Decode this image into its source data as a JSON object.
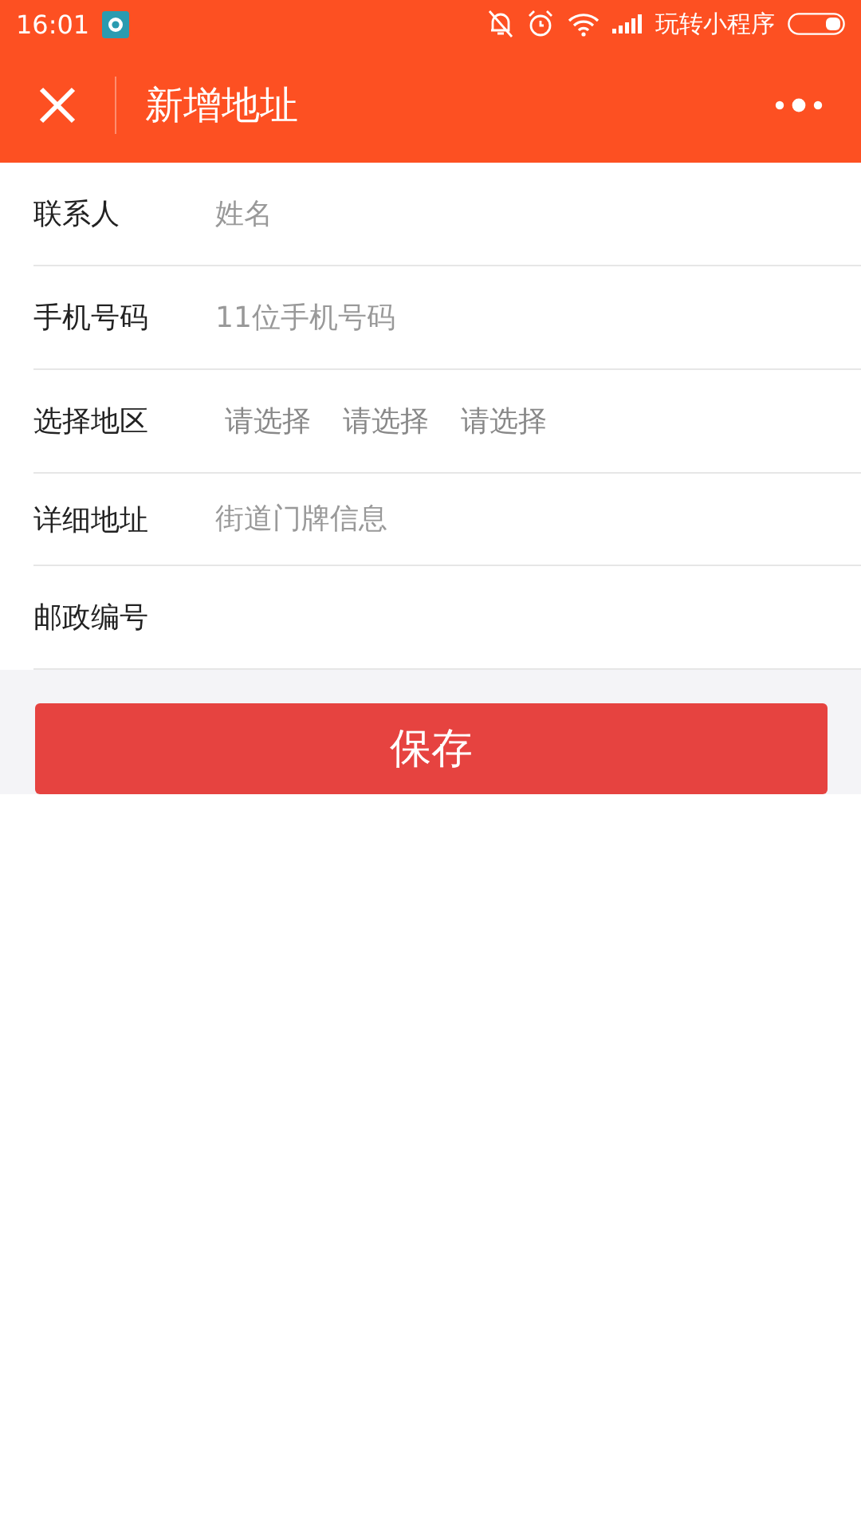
{
  "status_bar": {
    "time": "16:01",
    "carrier": "玩转小程序"
  },
  "nav": {
    "title": "新增地址"
  },
  "fields": [
    {
      "kind": "input",
      "label": "联系人",
      "placeholder": "姓名"
    },
    {
      "kind": "input",
      "label": "手机号码",
      "placeholder": "11位手机号码"
    },
    {
      "kind": "region",
      "label": "选择地区",
      "options": [
        "请选择",
        "请选择",
        "请选择"
      ]
    },
    {
      "kind": "input",
      "label": "详细地址",
      "placeholder": "街道门牌信息"
    },
    {
      "kind": "input",
      "label": "邮政编号"
    }
  ],
  "save_button": "保存"
}
